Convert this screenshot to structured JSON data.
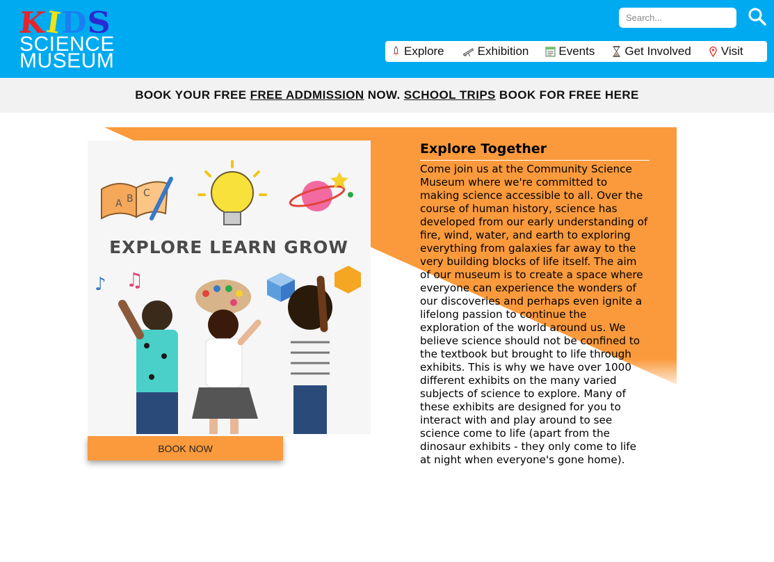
{
  "header": {
    "logo": {
      "kids_letters": [
        "K",
        "I",
        "D",
        "S"
      ],
      "line2": "SCIENCE",
      "line3": "MUSEUM"
    },
    "search": {
      "placeholder": "Search..."
    },
    "nav": [
      {
        "label": "Explore",
        "icon": "rocket-icon"
      },
      {
        "label": "Exhibition",
        "icon": "telescope-icon"
      },
      {
        "label": "Events",
        "icon": "calendar-icon"
      },
      {
        "label": "Get Involved",
        "icon": "hourglass-icon"
      },
      {
        "label": "Visit",
        "icon": "location-pin-icon"
      }
    ]
  },
  "banner": {
    "part1": "BOOK YOUR FREE ",
    "link1": "FREE ADDMISSION",
    "part2": " NOW. ",
    "link2": "SCHOOL TRIPS",
    "part3": " BOOK FOR FREE HERE"
  },
  "main": {
    "image_caption": "EXPLORE LEARN GROW",
    "book_button": "BOOK NOW",
    "article_title": "Explore Together",
    "article_body": "Come join us at the Community Science Museum where we're committed to making science accessible to all. Over the course of human history, science has developed from our early understanding of fire, wind, water, and earth to exploring everything from galaxies far away to the very building blocks of life itself. The aim of our museum is to create a space where everyone can experience the wonders of our discoveries and perhaps even ignite a lifelong passion to continue the exploration of the world around us. We believe science should not be confined to the textbook but brought to life through exhibits. This is why we have over 1000 different exhibits on the many varied subjects of science to explore. Many of these exhibits are designed for you to interact with and play around to see science come to life (apart from the dinosaur exhibits - they only come to life at night when everyone's gone home)."
  },
  "colors": {
    "header_bg": "#00aaf0",
    "banner_bg": "#f2f2f2",
    "accent_orange": "#fa9a3c"
  }
}
